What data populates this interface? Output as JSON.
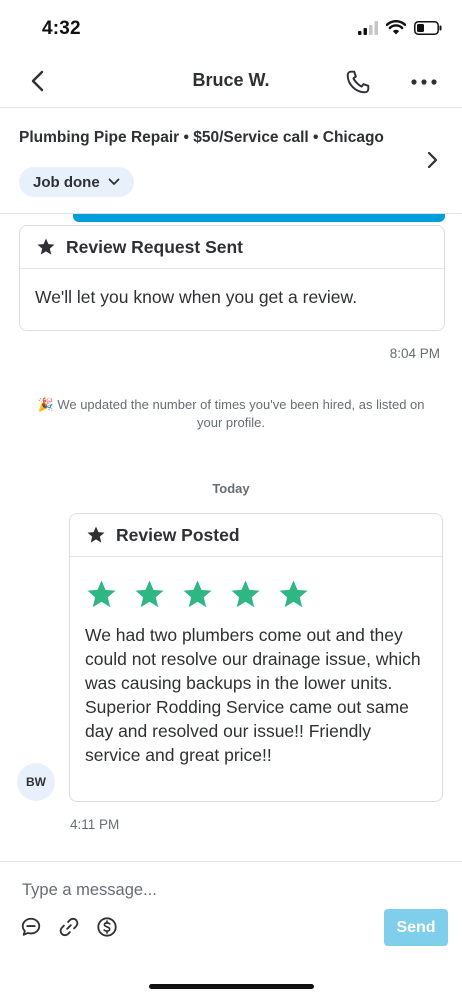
{
  "status_bar": {
    "time": "4:32"
  },
  "header": {
    "title": "Bruce W."
  },
  "job": {
    "title": "Plumbing Pipe Repair • $50/Service call • Chicago",
    "status": "Job done"
  },
  "messages": {
    "review_request": {
      "title": "Review Request Sent",
      "body": "We'll let you know when you get a review.",
      "time": "8:04 PM"
    },
    "system": {
      "emoji": "🎉",
      "text": "We updated the number of times you've been hired, as listed on your profile."
    },
    "date_divider": "Today",
    "review_posted": {
      "title": "Review Posted",
      "rating": 5,
      "body": "We had two plumbers come out and they could not resolve our drainage issue, which was causing backups in the lower units.  Superior Rodding Service came out same day and resolved our issue!! Friendly service and great price!!",
      "time": "4:11 PM",
      "avatar_initials": "BW"
    }
  },
  "composer": {
    "placeholder": "Type a message...",
    "send_label": "Send"
  },
  "colors": {
    "accent_blue": "#009fd9",
    "star_green": "#2db783",
    "pill_bg": "#e8f1fb",
    "send_disabled": "#7fcfec"
  }
}
